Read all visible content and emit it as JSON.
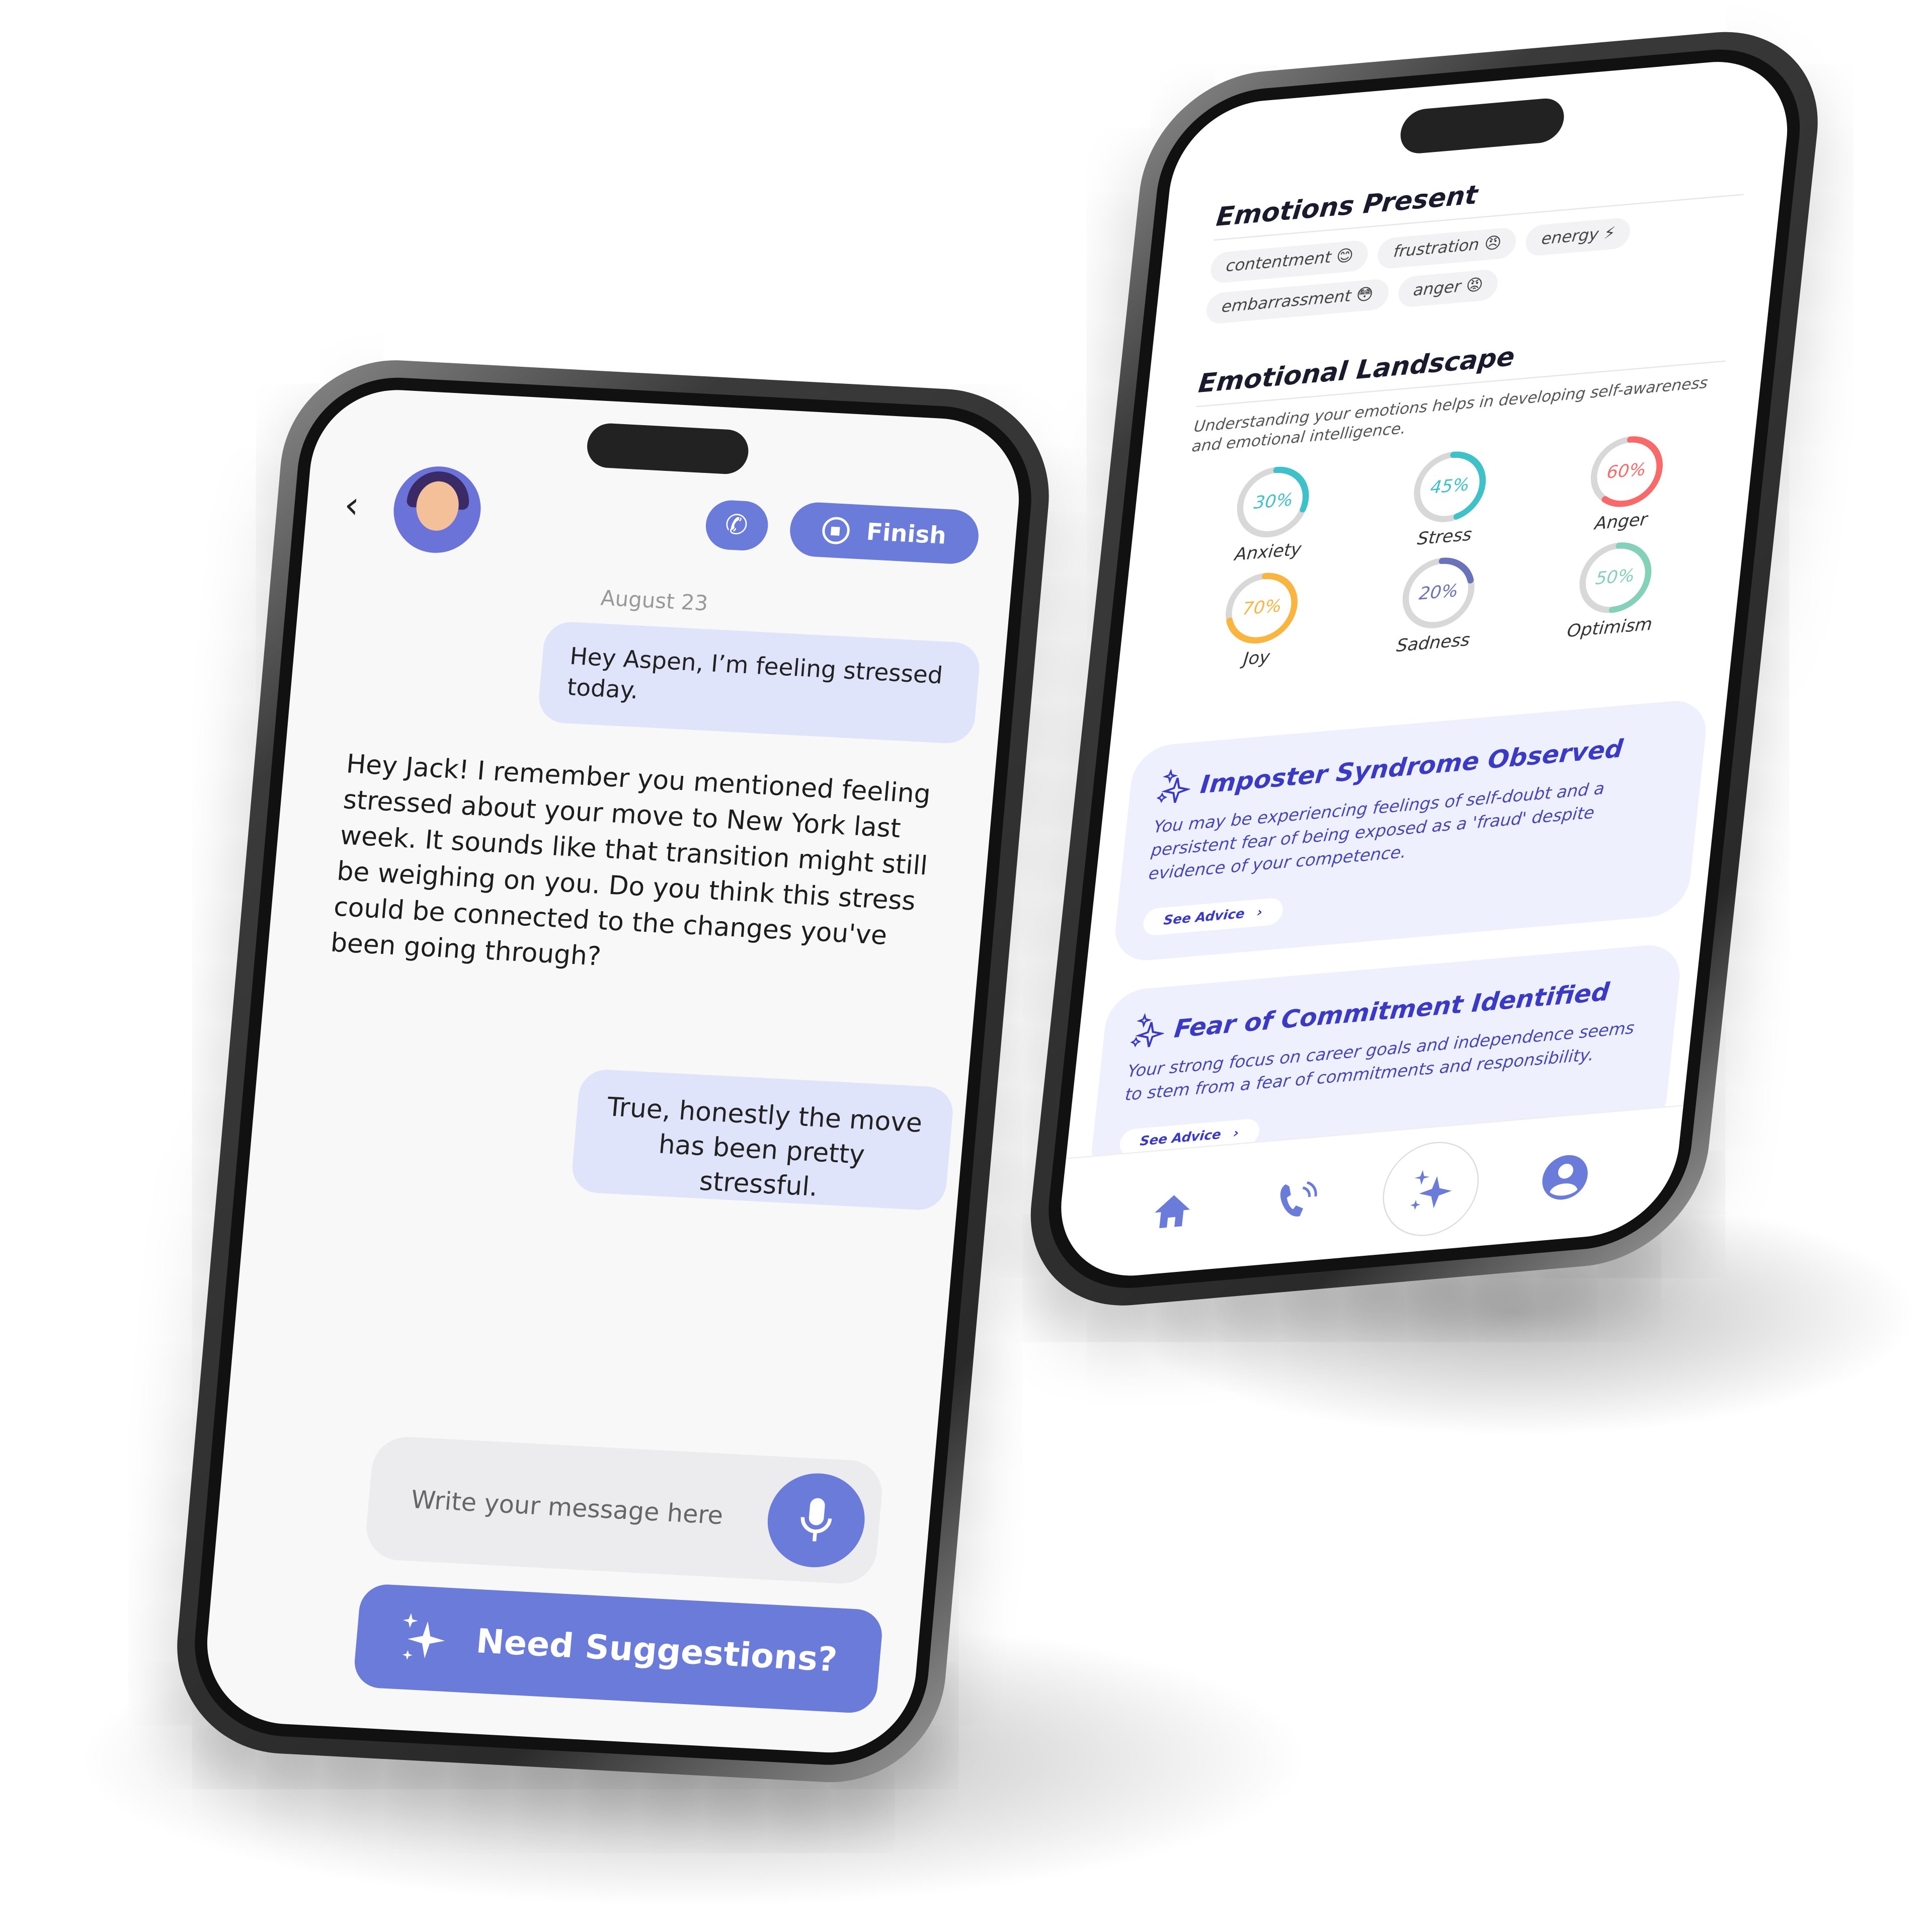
{
  "chat": {
    "date": "August 23",
    "finish_label": "Finish",
    "messages": [
      {
        "from": "user",
        "text": "Hey Aspen, I’m feeling stressed today."
      },
      {
        "from": "assistant",
        "text": "Hey Jack! I remember you mentioned feeling stressed about your move to New York last week. It sounds like that transition might still be weighing on you. Do you think this stress could be connected to the changes you've been going through?"
      },
      {
        "from": "user",
        "text": "True, honestly the move has been pretty stressful."
      }
    ],
    "input_placeholder": "Write your message here",
    "suggest_label": "Need Suggestions?",
    "accent": "#6b7bd9"
  },
  "insights": {
    "emotions_title": "Emotions Present",
    "emotions": [
      {
        "label": "contentment",
        "emoji": "😊"
      },
      {
        "label": "frustration",
        "emoji": "😠"
      },
      {
        "label": "energy",
        "emoji": "⚡"
      },
      {
        "label": "embarrassment",
        "emoji": "😳"
      },
      {
        "label": "anger",
        "emoji": "😡"
      }
    ],
    "landscape_title": "Emotional Landscape",
    "landscape_sub": "Understanding your emotions helps in developing self-awareness and emotional intelligence.",
    "rings": [
      {
        "label": "Anxiety",
        "percent": 30,
        "pct_text": "30%",
        "color": "#3fc1c9"
      },
      {
        "label": "Stress",
        "percent": 45,
        "pct_text": "45%",
        "color": "#3fc1c9"
      },
      {
        "label": "Anger",
        "percent": 60,
        "pct_text": "60%",
        "color": "#f86a6a"
      },
      {
        "label": "Joy",
        "percent": 70,
        "pct_text": "70%",
        "color": "#f9b53f"
      },
      {
        "label": "Sadness",
        "percent": 20,
        "pct_text": "20%",
        "color": "#6a73b8"
      },
      {
        "label": "Optimism",
        "percent": 50,
        "pct_text": "50%",
        "color": "#84d0b8"
      }
    ],
    "cards": [
      {
        "title": "Imposter Syndrome Observed",
        "body": "You may be experiencing feelings of self-doubt and a persistent fear of being exposed as a 'fraud' despite evidence of your competence.",
        "cta": "See Advice"
      },
      {
        "title": "Fear of Commitment Identified",
        "body": "Your strong focus on career goals and independence seems to stem from a fear of commitments and responsibility.",
        "cta": "See Advice"
      }
    ],
    "tabs": [
      "home-icon",
      "call-icon",
      "sparkles-icon",
      "profile-icon"
    ],
    "active_tab": "sparkles-icon"
  }
}
